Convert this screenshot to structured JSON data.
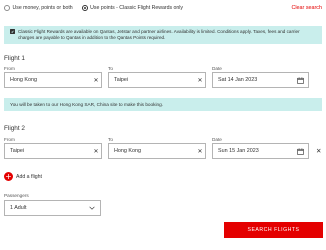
{
  "fare_options": {
    "option_money": "Use money, points or both",
    "option_points": "Use points - Classic Flight Rewards only",
    "selected": "option_points",
    "clear_label": "Clear search"
  },
  "classic_notice": {
    "icon": "plane-icon",
    "text": "Classic Flight Rewards are available on Qantas, Jetstar and partner airlines. Availability is limited. Conditions apply. Taxes, fees and carrier charges are payable to Qantas in addition to the Qantas Points required."
  },
  "flights": [
    {
      "title": "Flight 1",
      "from_label": "From",
      "from_value": "Hong Kong",
      "to_label": "To",
      "to_value": "Taipei",
      "date_label": "Date",
      "date_value": "Sat 14 Jan 2023"
    },
    {
      "title": "Flight 2",
      "from_label": "From",
      "from_value": "Taipei",
      "to_label": "To",
      "to_value": "Hong Kong",
      "date_label": "Date",
      "date_value": "Sun 15 Jan 2023"
    }
  ],
  "token_notice": "You will be taken to our Hong Kong SAR, China site to make this booking.",
  "add_flight_label": "Add a flight",
  "passengers": {
    "label": "Passengers",
    "value": "1 Adult"
  },
  "search_button": "SEARCH FLIGHTS",
  "colors": {
    "brand_red": "#e40000",
    "notice_bg": "#c9eeec",
    "text": "#323232",
    "border": "#b4b4b4"
  }
}
